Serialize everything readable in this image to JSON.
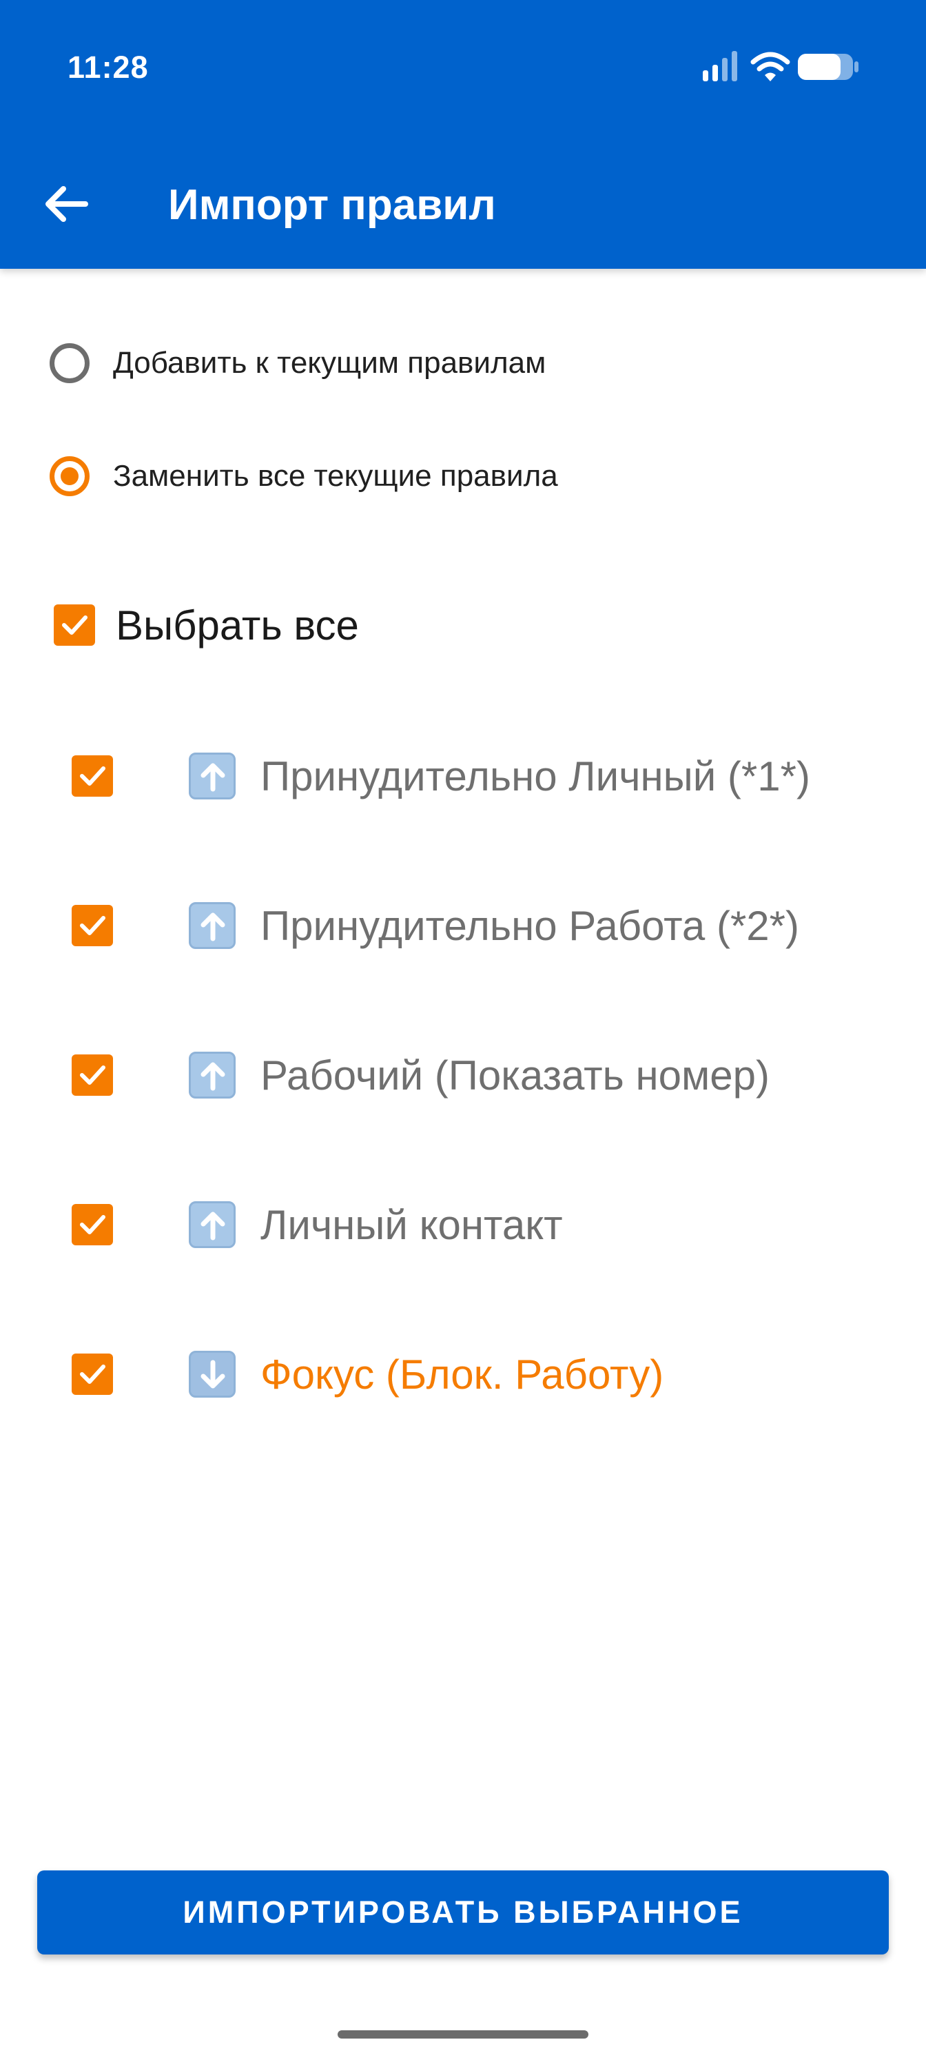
{
  "status_bar": {
    "time": "11:28",
    "icons": [
      "cellular-signal-icon",
      "wifi-icon",
      "battery-icon"
    ],
    "battery_level": 0.75
  },
  "appbar": {
    "title": "Импорт правил",
    "back_icon": "arrow-left-icon",
    "color": "#0062CC"
  },
  "import_mode": {
    "options": [
      {
        "label": "Добавить к текущим правилам",
        "selected": false
      },
      {
        "label": "Заменить все текущие правила",
        "selected": true
      }
    ]
  },
  "select_all": {
    "label": "Выбрать все",
    "checked": true
  },
  "rules": [
    {
      "label": "Принудительно Личный (*1*)",
      "checked": true,
      "direction_icon": "up-arrow-icon",
      "highlight": false
    },
    {
      "label": "Принудительно Работа (*2*)",
      "checked": true,
      "direction_icon": "up-arrow-icon",
      "highlight": false
    },
    {
      "label": "Рабочий (Показать номер)",
      "checked": true,
      "direction_icon": "up-arrow-icon",
      "highlight": false
    },
    {
      "label": "Личный контакт",
      "checked": true,
      "direction_icon": "up-arrow-icon",
      "highlight": false
    },
    {
      "label": "Фокус (Блок. Работу)",
      "checked": true,
      "direction_icon": "down-arrow-icon",
      "highlight": true
    }
  ],
  "import_button": {
    "label": "ИМПОРТИРОВАТЬ ВЫБРАННОЕ"
  },
  "colors": {
    "primary": "#0062CC",
    "accent": "#F57C00",
    "text_muted": "#6f6f6f"
  }
}
